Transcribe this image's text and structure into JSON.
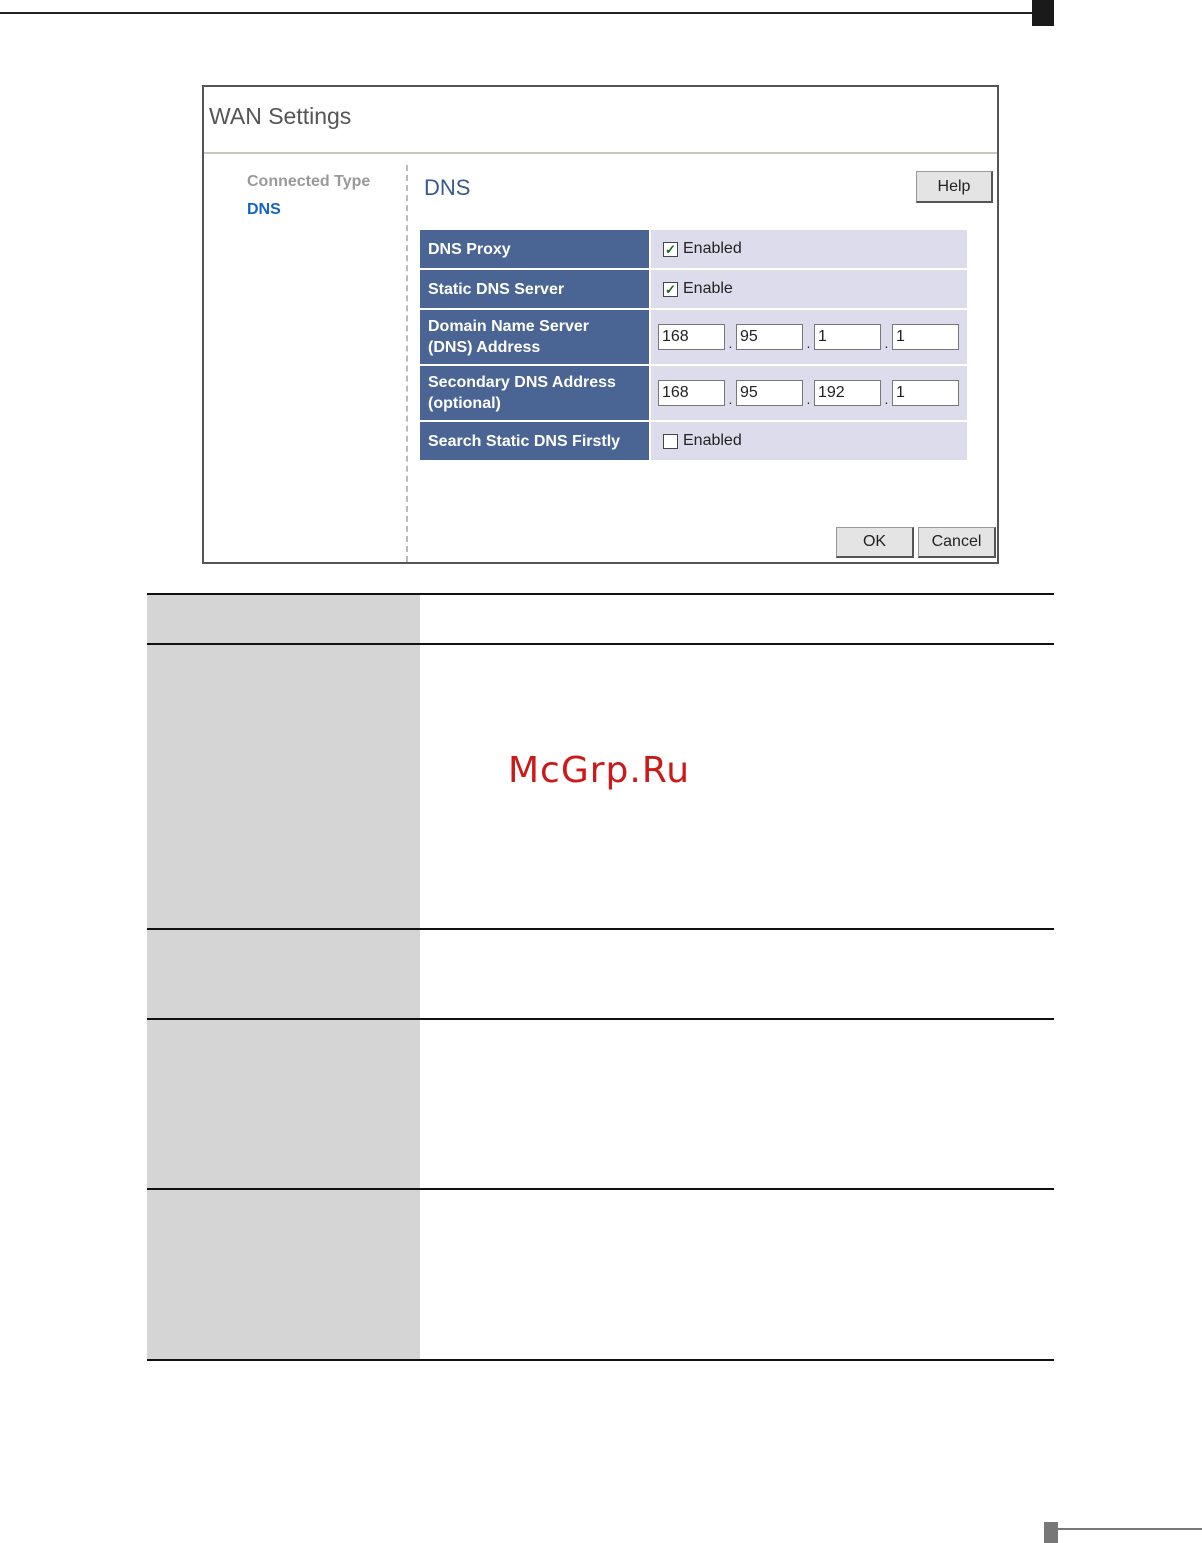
{
  "window": {
    "title": "WAN Settings"
  },
  "nav": {
    "items": [
      {
        "label": "Connected Type",
        "active": false
      },
      {
        "label": "DNS",
        "active": true
      }
    ]
  },
  "section": {
    "title": "DNS",
    "help_label": "Help"
  },
  "settings": {
    "dns_proxy": {
      "label": "DNS Proxy",
      "checked": true,
      "option": "Enabled"
    },
    "static_dns": {
      "label": "Static DNS Server",
      "checked": true,
      "option": "Enable"
    },
    "primary_dns": {
      "label_line1": "Domain Name Server",
      "label_line2": "(DNS) Address",
      "octets": [
        "168",
        "95",
        "1",
        "1"
      ]
    },
    "secondary_dns": {
      "label_line1": "Secondary DNS Address",
      "label_line2": "(optional)",
      "octets": [
        "168",
        "95",
        "192",
        "1"
      ]
    },
    "search_static_first": {
      "label": "Search Static DNS Firstly",
      "checked": false,
      "option": "Enabled"
    }
  },
  "actions": {
    "ok_label": "OK",
    "cancel_label": "Cancel"
  },
  "watermark": "McGrp.Ru",
  "colors": {
    "label_bg": "#4a6594",
    "value_bg": "#dcdcec",
    "nav_active": "#1565c0",
    "title": "#3a5a8c",
    "watermark": "#cc1a1a"
  }
}
